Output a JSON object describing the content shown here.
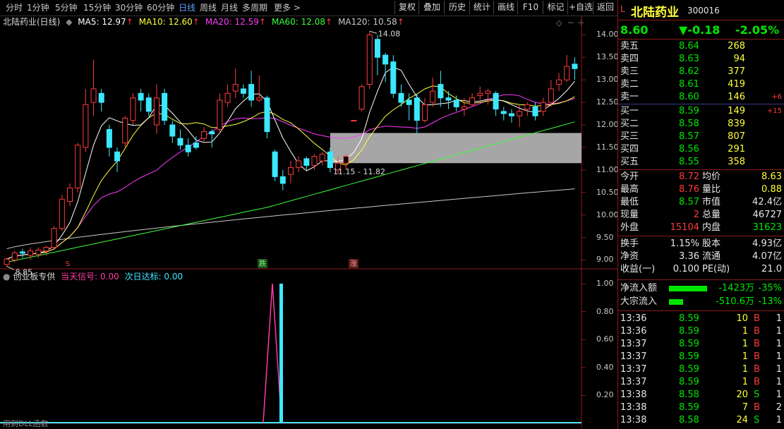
{
  "toolbar": {
    "periods": [
      "分时",
      "1分钟",
      "5分钟",
      "15分钟",
      "30分钟",
      "60分钟",
      "日线",
      "周线",
      "月线",
      "多周期",
      "更多 >"
    ],
    "active_period": "日线",
    "buttons": [
      "复权",
      "叠加",
      "历史",
      "统计",
      "画线",
      "F10",
      "标记",
      "+自选",
      "返回"
    ]
  },
  "chart": {
    "stock_title": "北陆药业(日线)",
    "ma": [
      {
        "label": "MA5: 12.97",
        "color": "#ffffff"
      },
      {
        "label": "MA10: 12.60",
        "color": "#ffff3b"
      },
      {
        "label": "MA20: 12.59",
        "color": "#ff3bff"
      },
      {
        "label": "MA60: 12.08",
        "color": "#3bff3b"
      },
      {
        "label": "MA120: 10.58",
        "color": "#c8c8c8"
      }
    ],
    "price_axis": [
      "14.00",
      "13.50",
      "13.00",
      "12.50",
      "12.00",
      "11.50",
      "11.00",
      "10.50",
      "10.00",
      "9.50",
      "9.00"
    ],
    "high_label": "14.08",
    "low_label": "8.85",
    "zone_label": "11.15 - 11.82",
    "marker_fall": "跌",
    "marker_rise": "涨",
    "marker_s": "S"
  },
  "indicator": {
    "name": "创业板专供",
    "sig1": "当天信号: 0.00",
    "sig2": "次日达标: 0.00",
    "axis": [
      "1.00",
      "0.80",
      "0.60",
      "0.40",
      "0.20"
    ],
    "footer": "用到DLL函数"
  },
  "chart_data": {
    "type": "candlestick",
    "ylim": [
      8.85,
      14.1
    ],
    "candles": [
      [
        8.9,
        9.02,
        8.85,
        9.05
      ],
      [
        9.0,
        9.16,
        8.95,
        9.2
      ],
      [
        9.18,
        9.15,
        9.05,
        9.25
      ],
      [
        9.1,
        9.2,
        9.0,
        9.28
      ],
      [
        9.12,
        9.22,
        9.05,
        9.28
      ],
      [
        9.2,
        9.28,
        9.1,
        9.32
      ],
      [
        9.28,
        9.7,
        9.22,
        9.75
      ],
      [
        9.7,
        10.35,
        9.65,
        10.45
      ],
      [
        10.3,
        10.6,
        10.2,
        10.7
      ],
      [
        10.6,
        11.55,
        10.5,
        11.6
      ],
      [
        11.5,
        12.45,
        11.4,
        12.8
      ],
      [
        12.5,
        12.8,
        12.2,
        13.45
      ],
      [
        12.7,
        12.5,
        12.3,
        12.8
      ],
      [
        11.9,
        11.5,
        11.3,
        12.0
      ],
      [
        11.4,
        11.2,
        10.95,
        11.5
      ],
      [
        11.6,
        12.15,
        11.5,
        12.2
      ],
      [
        12.1,
        12.6,
        12.0,
        12.7
      ],
      [
        12.7,
        12.55,
        12.3,
        12.8
      ],
      [
        12.6,
        12.3,
        12.2,
        12.7
      ],
      [
        12.0,
        12.6,
        11.8,
        12.9
      ],
      [
        12.7,
        12.1,
        12.0,
        12.8
      ],
      [
        12.0,
        11.75,
        11.6,
        12.1
      ],
      [
        11.7,
        11.55,
        11.45,
        11.9
      ],
      [
        11.55,
        11.4,
        11.3,
        11.7
      ],
      [
        11.6,
        11.5,
        11.45,
        11.75
      ],
      [
        11.7,
        11.85,
        11.6,
        11.95
      ],
      [
        11.85,
        11.8,
        11.5,
        11.9
      ],
      [
        11.9,
        12.55,
        11.8,
        12.7
      ],
      [
        12.5,
        12.7,
        12.4,
        12.9
      ],
      [
        12.75,
        12.9,
        12.6,
        13.25
      ],
      [
        12.8,
        12.7,
        12.6,
        12.9
      ],
      [
        12.9,
        12.55,
        12.4,
        13.2
      ],
      [
        12.55,
        12.6,
        12.5,
        13.1
      ],
      [
        12.6,
        11.85,
        11.7,
        12.65
      ],
      [
        11.4,
        10.85,
        10.75,
        11.45
      ],
      [
        10.85,
        10.7,
        10.55,
        11.0
      ],
      [
        10.9,
        11.05,
        10.7,
        11.2
      ],
      [
        11.05,
        11.2,
        10.95,
        11.3
      ],
      [
        11.25,
        11.1,
        11.0,
        11.3
      ],
      [
        11.1,
        11.3,
        11.0,
        11.35
      ],
      [
        11.2,
        11.35,
        11.1,
        11.4
      ],
      [
        11.4,
        11.05,
        10.95,
        11.5
      ],
      [
        11.0,
        11.15,
        10.9,
        11.3
      ],
      [
        11.15,
        11.3,
        11.0,
        11.35
      ],
      [
        12.1,
        12.1,
        12.1,
        12.1
      ],
      [
        12.35,
        12.85,
        12.3,
        12.9
      ],
      [
        12.9,
        14.0,
        12.8,
        14.08
      ],
      [
        13.9,
        13.5,
        13.1,
        14.0
      ],
      [
        13.55,
        13.35,
        12.95,
        13.6
      ],
      [
        13.4,
        12.7,
        12.6,
        13.55
      ],
      [
        12.7,
        12.5,
        12.4,
        12.9
      ],
      [
        12.55,
        12.45,
        12.1,
        12.7
      ],
      [
        12.6,
        12.1,
        11.8,
        12.7
      ],
      [
        12.1,
        12.45,
        12.05,
        12.6
      ],
      [
        12.5,
        12.75,
        12.4,
        13.05
      ],
      [
        12.9,
        12.6,
        12.4,
        13.2
      ],
      [
        12.6,
        12.55,
        12.35,
        12.75
      ],
      [
        12.55,
        12.4,
        12.3,
        12.65
      ],
      [
        12.35,
        12.4,
        12.2,
        12.6
      ],
      [
        12.45,
        12.6,
        12.4,
        12.7
      ],
      [
        12.65,
        12.7,
        12.55,
        12.85
      ],
      [
        12.7,
        12.75,
        12.45,
        12.8
      ],
      [
        12.7,
        12.35,
        12.2,
        12.75
      ],
      [
        12.3,
        12.25,
        12.1,
        12.4
      ],
      [
        12.25,
        12.2,
        12.05,
        12.35
      ],
      [
        12.2,
        12.3,
        11.95,
        12.45
      ],
      [
        12.35,
        12.45,
        12.2,
        12.5
      ],
      [
        12.4,
        12.2,
        12.1,
        12.5
      ],
      [
        12.3,
        12.5,
        12.2,
        12.6
      ],
      [
        12.5,
        12.8,
        12.4,
        13.0
      ],
      [
        12.9,
        13.0,
        12.75,
        13.15
      ],
      [
        13.0,
        13.3,
        12.95,
        13.55
      ],
      [
        13.35,
        13.25,
        13.0,
        13.5
      ]
    ],
    "zone": [
      11.15,
      11.82
    ]
  },
  "panel": {
    "name": "北陆药业",
    "code": "300016",
    "price": "8.60",
    "change": "▼-0.18",
    "pct": "-2.05%",
    "asks": [
      {
        "label": "卖五",
        "price": "8.64",
        "vol": "268",
        "chg": ""
      },
      {
        "label": "卖四",
        "price": "8.63",
        "vol": "94",
        "chg": ""
      },
      {
        "label": "卖三",
        "price": "8.62",
        "vol": "377",
        "chg": ""
      },
      {
        "label": "卖二",
        "price": "8.61",
        "vol": "419",
        "chg": ""
      },
      {
        "label": "卖一",
        "price": "8.60",
        "vol": "146",
        "chg": "+6"
      }
    ],
    "bids": [
      {
        "label": "买一",
        "price": "8.59",
        "vol": "149",
        "chg": "+15"
      },
      {
        "label": "买二",
        "price": "8.58",
        "vol": "839",
        "chg": ""
      },
      {
        "label": "买三",
        "price": "8.57",
        "vol": "807",
        "chg": ""
      },
      {
        "label": "买四",
        "price": "8.56",
        "vol": "291",
        "chg": ""
      },
      {
        "label": "买五",
        "price": "8.55",
        "vol": "358",
        "chg": ""
      }
    ],
    "stats": [
      {
        "l1": "今开",
        "v1": "8.72",
        "c1": "red",
        "l2": "均价",
        "v2": "8.63",
        "c2": "yellow"
      },
      {
        "l1": "最高",
        "v1": "8.76",
        "c1": "red",
        "l2": "量比",
        "v2": "0.88",
        "c2": "yellow"
      },
      {
        "l1": "最低",
        "v1": "8.57",
        "c1": "green",
        "l2": "市值",
        "v2": "42.4亿",
        "c2": "white"
      },
      {
        "l1": "现量",
        "v1": "2",
        "c1": "red",
        "l2": "总量",
        "v2": "46727",
        "c2": "white"
      },
      {
        "l1": "外盘",
        "v1": "15104",
        "c1": "red",
        "l2": "内盘",
        "v2": "31623",
        "c2": "green"
      },
      {
        "l1": "换手",
        "v1": "1.15%",
        "c1": "white",
        "l2": "股本",
        "v2": "4.93亿",
        "c2": "white"
      },
      {
        "l1": "净资",
        "v1": "3.36",
        "c1": "white",
        "l2": "流通",
        "v2": "4.07亿",
        "c2": "white"
      },
      {
        "l1": "收益(一)",
        "v1": "0.100",
        "c1": "white",
        "l2": "PE(动)",
        "v2": "21.0",
        "c2": "white"
      }
    ],
    "flows": [
      {
        "label": "净流入额",
        "value": "-1423万",
        "pct": "-35%",
        "bar": 0.35
      },
      {
        "label": "大宗流入",
        "value": "-510.6万",
        "pct": "-13%",
        "bar": 0.13
      }
    ],
    "ticks": [
      {
        "time": "13:36",
        "price": "8.59",
        "vol": "10",
        "side": "B",
        "n": "1"
      },
      {
        "time": "13:36",
        "price": "8.59",
        "vol": "1",
        "side": "B",
        "n": "1"
      },
      {
        "time": "13:37",
        "price": "8.59",
        "vol": "1",
        "side": "B",
        "n": "1"
      },
      {
        "time": "13:37",
        "price": "8.59",
        "vol": "1",
        "side": "B",
        "n": "1"
      },
      {
        "time": "13:37",
        "price": "8.59",
        "vol": "1",
        "side": "B",
        "n": "1"
      },
      {
        "time": "13:37",
        "price": "8.59",
        "vol": "1",
        "side": "B",
        "n": "1"
      },
      {
        "time": "13:38",
        "price": "8.58",
        "vol": "20",
        "side": "S",
        "n": "1"
      },
      {
        "time": "13:38",
        "price": "8.59",
        "vol": "7",
        "side": "B",
        "n": "2"
      },
      {
        "time": "13:38",
        "price": "8.58",
        "vol": "24",
        "side": "S",
        "n": "1"
      }
    ]
  }
}
